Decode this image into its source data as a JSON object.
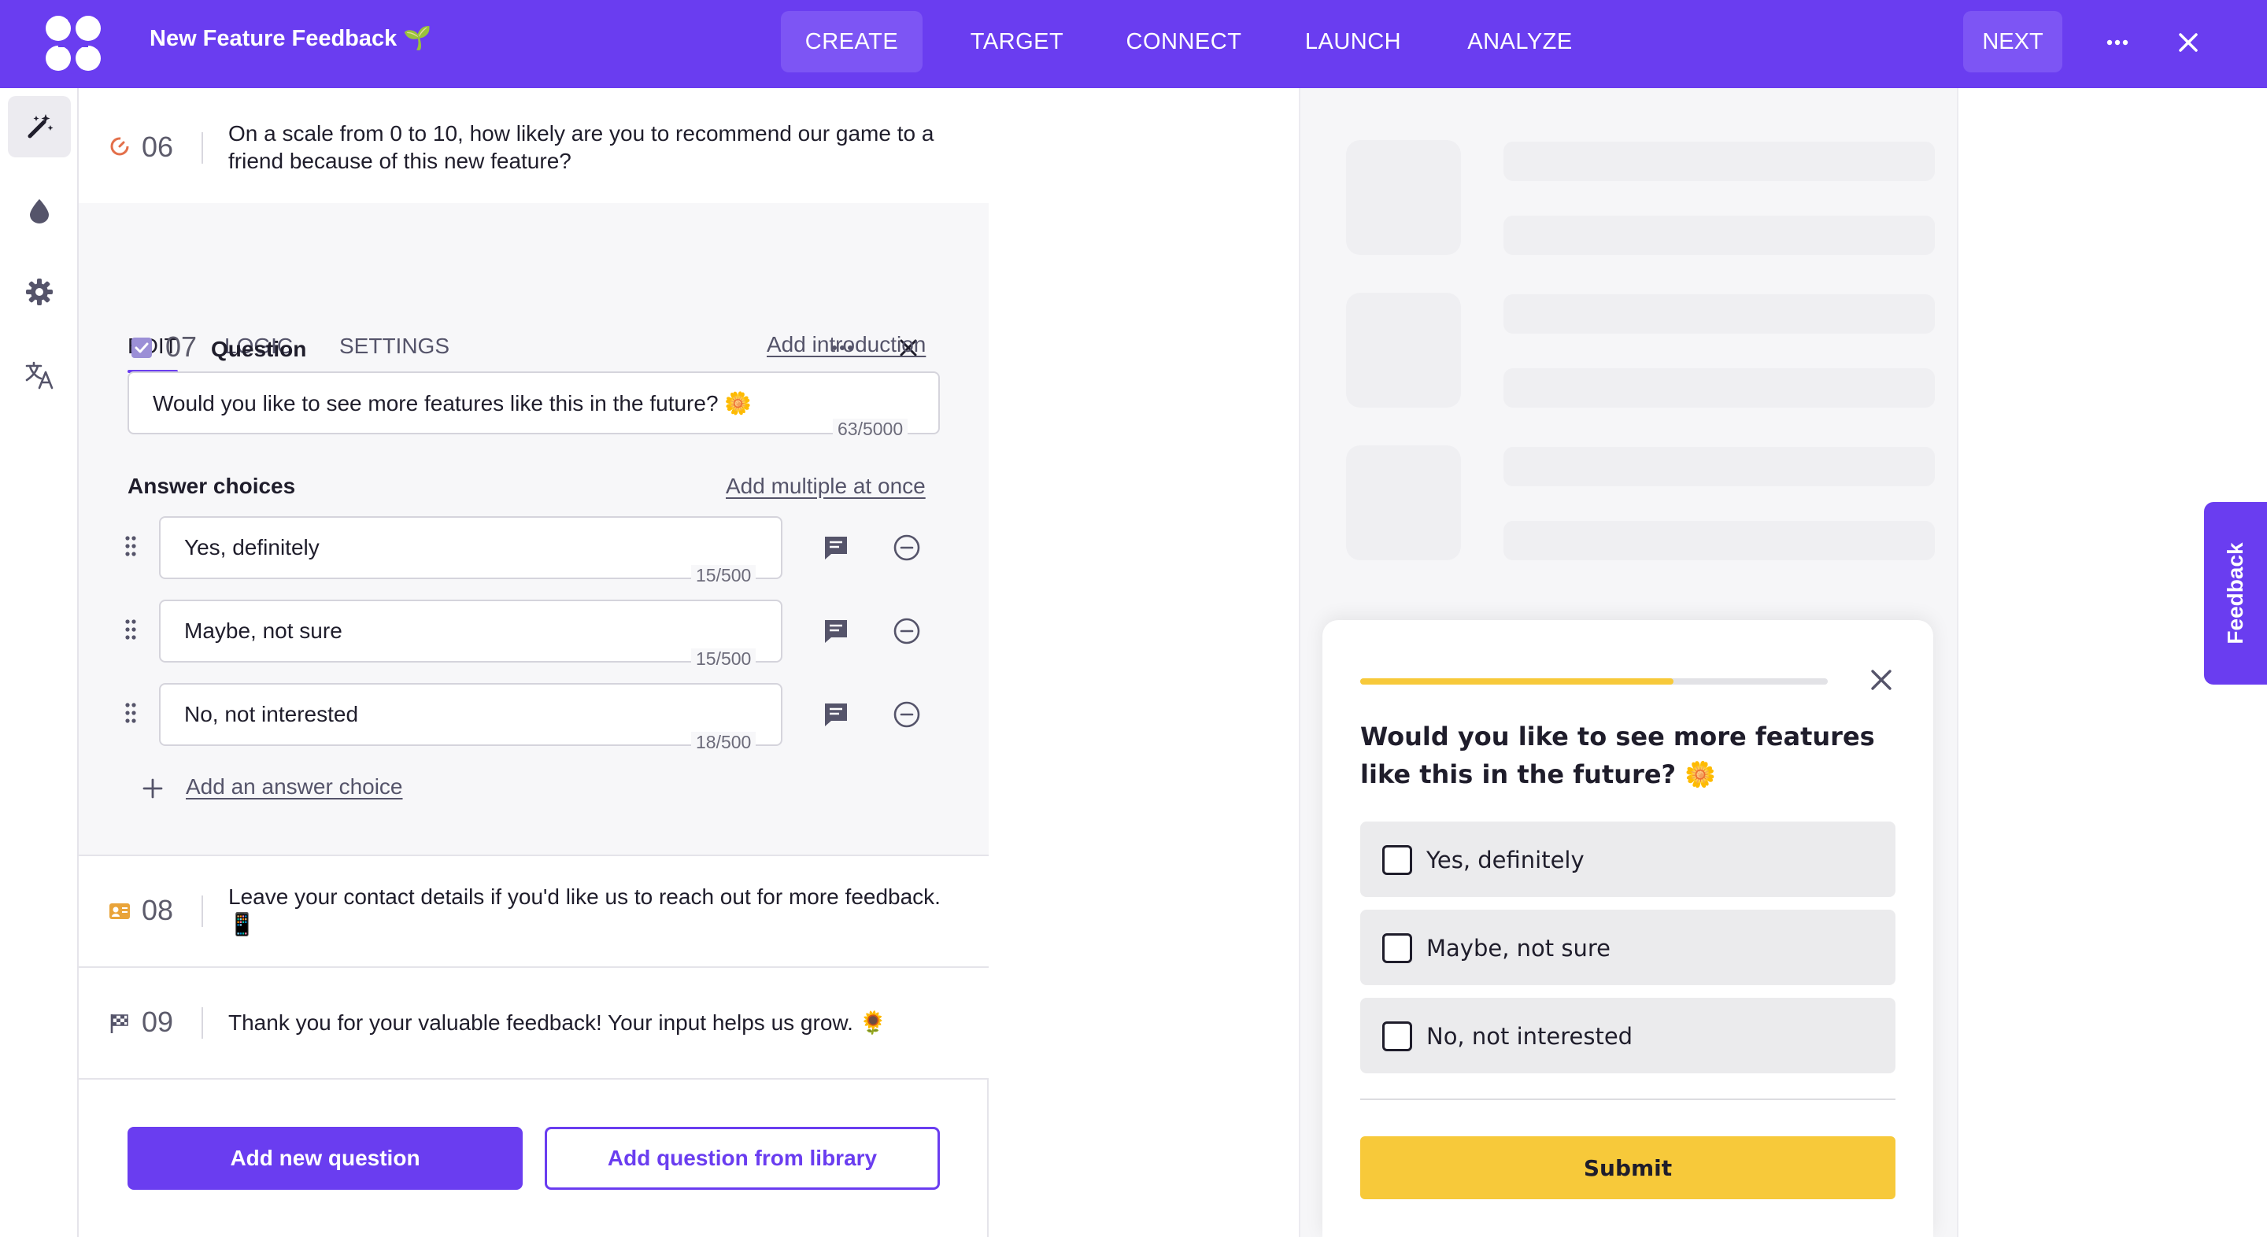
{
  "header": {
    "title": "New Feature Feedback",
    "title_emoji": "🌱",
    "nav": [
      "CREATE",
      "TARGET",
      "CONNECT",
      "LAUNCH",
      "ANALYZE"
    ],
    "active_nav": "CREATE",
    "next_label": "NEXT",
    "accent_color": "#6a3df0"
  },
  "sidebar": {
    "icons": [
      "magic-wand-icon",
      "drop-icon",
      "gear-icon",
      "translate-icon"
    ]
  },
  "questions": {
    "q06": {
      "number": "06",
      "text": "On a scale from 0 to 10, how likely are you to recommend our game to a friend because of this new feature?"
    },
    "q08": {
      "number": "08",
      "text": "Leave your contact details if you'd like us to reach out for more feedback. 📱"
    },
    "q09": {
      "number": "09",
      "text": "Thank you for your valuable feedback! Your input helps us grow. 🌻"
    }
  },
  "editor": {
    "tabs": [
      "EDIT",
      "LOGIC",
      "SETTINGS"
    ],
    "question_number": "07",
    "question_label": "Question",
    "add_introduction": "Add introduction",
    "question_text": "Would you like to see more features like this in the future? 🌼",
    "question_counter": "63/5000",
    "answer_choices_label": "Answer choices",
    "add_multiple": "Add multiple at once",
    "choices": [
      {
        "text": "Yes, definitely",
        "counter": "15/500"
      },
      {
        "text": "Maybe, not sure",
        "counter": "15/500"
      },
      {
        "text": "No, not interested",
        "counter": "18/500"
      }
    ],
    "add_choice": "Add an answer choice",
    "add_new_question": "Add new question",
    "add_from_library": "Add question from library"
  },
  "preview": {
    "question": "Would you like to see more features like this in the future? 🌼",
    "options": [
      "Yes, definitely",
      "Maybe, not sure",
      "No, not interested"
    ],
    "submit": "Submit",
    "progress": 0.67,
    "progress_color": "#f7c93a",
    "feedback_tab": "Feedback"
  }
}
